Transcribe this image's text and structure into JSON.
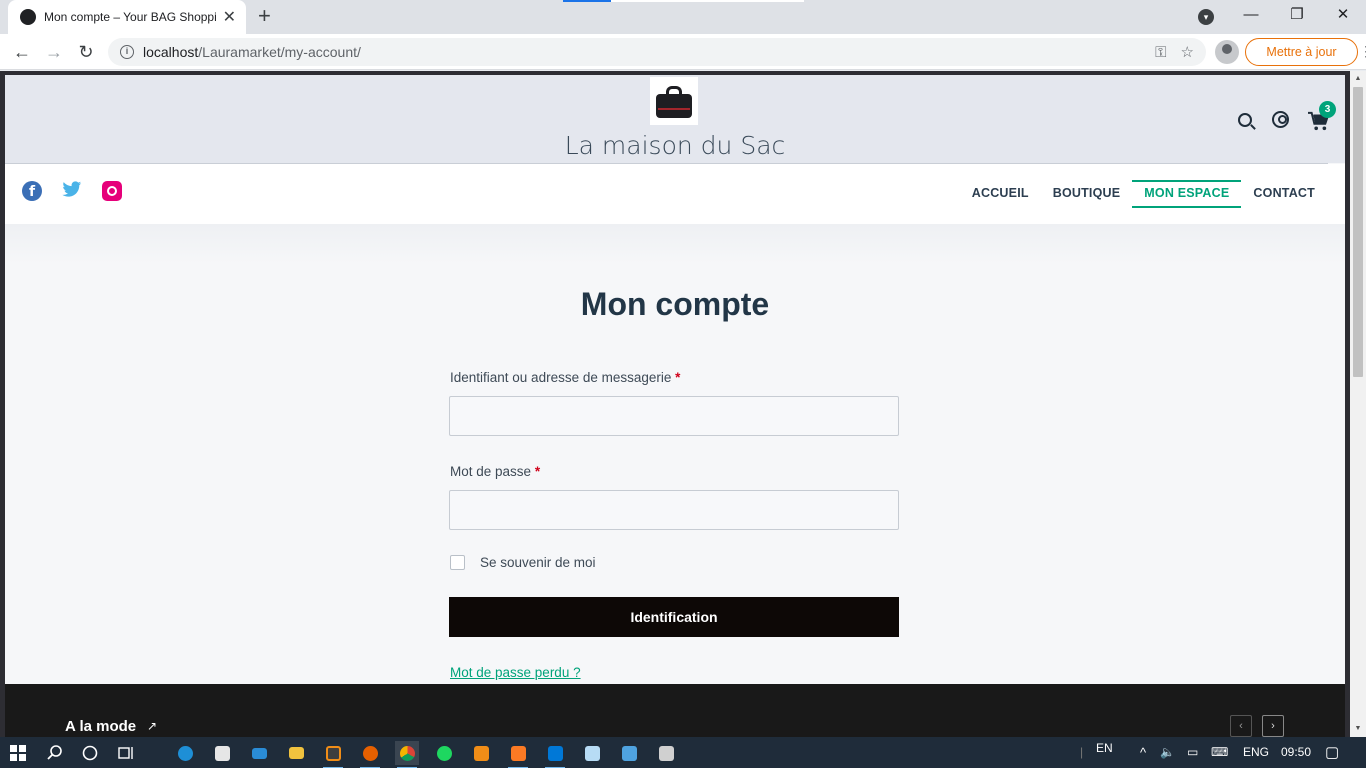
{
  "browser": {
    "tab_title": "Mon compte – Your BAG Shoppin",
    "url_host": "localhost",
    "url_path": "/Lauramarket/my-account/",
    "update_label": "Mettre à jour"
  },
  "site": {
    "title": "La maison du Sac",
    "cart_count": "3",
    "nav": [
      {
        "label": "ACCUEIL",
        "active": false
      },
      {
        "label": "BOUTIQUE",
        "active": false
      },
      {
        "label": "MON ESPACE",
        "active": true
      },
      {
        "label": "CONTACT",
        "active": false
      }
    ],
    "social": [
      "facebook-icon",
      "twitter-icon",
      "instagram-icon"
    ]
  },
  "form": {
    "heading": "Mon compte",
    "username_label": "Identifiant ou adresse de messagerie",
    "password_label": "Mot de passe",
    "required_mark": "*",
    "remember_label": "Se souvenir de moi",
    "submit_label": "Identification",
    "lost_password": "Mot de passe perdu ?"
  },
  "footer": {
    "trend_title": "A la mode"
  },
  "taskbar": {
    "language": "EN",
    "input_lang": "ENG",
    "time": "09:50",
    "apps": [
      "windows-start",
      "search",
      "cortana",
      "task-view",
      "edge",
      "store",
      "mail",
      "file-explorer",
      "sublime-text",
      "firefox",
      "chrome",
      "spotify",
      "git-tool",
      "xampp",
      "vscode",
      "notepad",
      "control-panel",
      "calculator"
    ]
  },
  "colors": {
    "accent": "#00a37a",
    "button": "#0d0806",
    "heading": "#223647",
    "footer": "#191919",
    "required": "#d0021b"
  }
}
